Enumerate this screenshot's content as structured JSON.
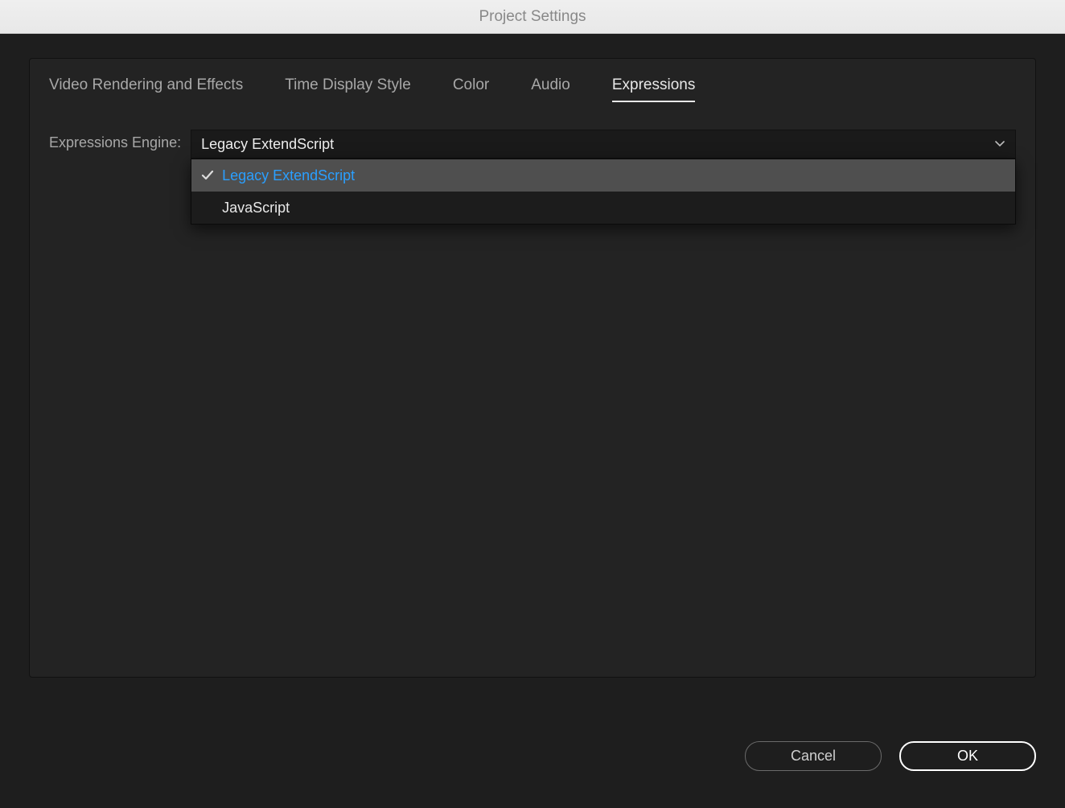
{
  "window": {
    "title": "Project Settings"
  },
  "tabs": [
    {
      "label": "Video Rendering and Effects",
      "active": false
    },
    {
      "label": "Time Display Style",
      "active": false
    },
    {
      "label": "Color",
      "active": false
    },
    {
      "label": "Audio",
      "active": false
    },
    {
      "label": "Expressions",
      "active": true
    }
  ],
  "field": {
    "label": "Expressions Engine:"
  },
  "dropdown": {
    "selected": "Legacy ExtendScript",
    "options": [
      {
        "label": "Legacy ExtendScript",
        "selected": true
      },
      {
        "label": "JavaScript",
        "selected": false
      }
    ]
  },
  "buttons": {
    "cancel": "Cancel",
    "ok": "OK"
  }
}
